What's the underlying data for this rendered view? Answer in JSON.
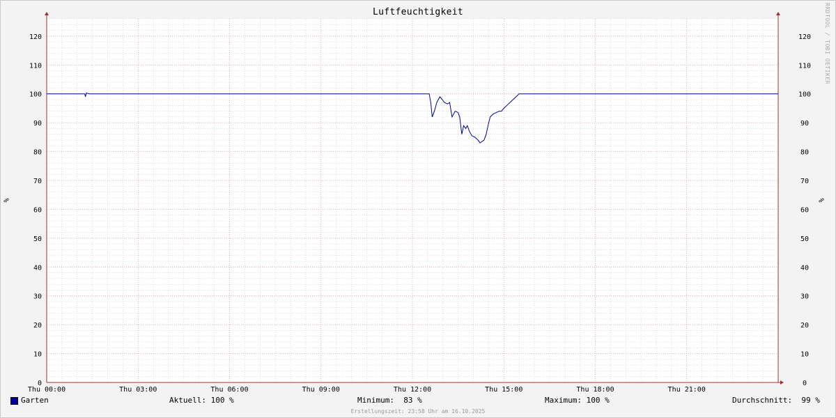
{
  "window": {
    "title": "Luftfeuchtigkeit",
    "watermark": "RRDTOOL / TOBI OETIKER",
    "footer": "Erstellungszeit: 23:58 Uhr am 16.10.2025"
  },
  "legend": {
    "series_name": "Garten",
    "series_color": "#000099",
    "current": "Aktuell: 100 %",
    "minimum": "Minimum:  83 %",
    "maximum": "Maximum: 100 %",
    "average": "Durchschnitt:  99 %"
  },
  "colors": {
    "background": "#f3f3f3",
    "plot_background": "#ffffff",
    "major_grid": "#e08a8a",
    "minor_grid": "#c8c8c8",
    "axis": "#a03030",
    "line": "#000099"
  },
  "chart_data": {
    "type": "line",
    "title": "Luftfeuchtigkeit",
    "xlabel": "",
    "ylabel": "%",
    "ylabel_right": "%",
    "xlim": [
      0,
      24
    ],
    "ylim": [
      0,
      126
    ],
    "x_unit": "hours since Thu 00:00",
    "yticks": [
      0,
      10,
      20,
      30,
      40,
      50,
      60,
      70,
      80,
      90,
      100,
      110,
      120
    ],
    "xticks": [
      {
        "x": 0,
        "label": "Thu 00:00"
      },
      {
        "x": 3,
        "label": "Thu 03:00"
      },
      {
        "x": 6,
        "label": "Thu 06:00"
      },
      {
        "x": 9,
        "label": "Thu 09:00"
      },
      {
        "x": 12,
        "label": "Thu 12:00"
      },
      {
        "x": 15,
        "label": "Thu 15:00"
      },
      {
        "x": 18,
        "label": "Thu 18:00"
      },
      {
        "x": 21,
        "label": "Thu 21:00"
      }
    ],
    "grid": true,
    "legend_position": "bottom",
    "series": [
      {
        "name": "Garten",
        "color": "#000099",
        "points": [
          [
            0,
            100
          ],
          [
            1.25,
            100
          ],
          [
            1.27,
            99
          ],
          [
            1.3,
            100.3
          ],
          [
            1.4,
            100
          ],
          [
            12.55,
            100
          ],
          [
            12.6,
            97
          ],
          [
            12.65,
            92
          ],
          [
            12.72,
            94
          ],
          [
            12.8,
            97
          ],
          [
            12.9,
            99
          ],
          [
            12.98,
            98
          ],
          [
            13.05,
            97
          ],
          [
            13.15,
            96.5
          ],
          [
            13.22,
            97
          ],
          [
            13.3,
            92
          ],
          [
            13.4,
            94
          ],
          [
            13.5,
            93.5
          ],
          [
            13.55,
            92
          ],
          [
            13.62,
            86
          ],
          [
            13.68,
            89
          ],
          [
            13.75,
            88
          ],
          [
            13.8,
            89
          ],
          [
            13.87,
            87
          ],
          [
            13.95,
            85.5
          ],
          [
            14.05,
            85
          ],
          [
            14.15,
            84
          ],
          [
            14.22,
            83
          ],
          [
            14.28,
            83.5
          ],
          [
            14.35,
            84
          ],
          [
            14.42,
            86
          ],
          [
            14.48,
            89
          ],
          [
            14.55,
            92
          ],
          [
            14.65,
            93
          ],
          [
            14.75,
            93.5
          ],
          [
            14.85,
            94
          ],
          [
            14.92,
            94
          ],
          [
            15.0,
            95
          ],
          [
            15.1,
            96
          ],
          [
            15.2,
            97
          ],
          [
            15.3,
            98
          ],
          [
            15.4,
            99
          ],
          [
            15.5,
            100
          ],
          [
            24,
            100
          ]
        ]
      }
    ]
  }
}
